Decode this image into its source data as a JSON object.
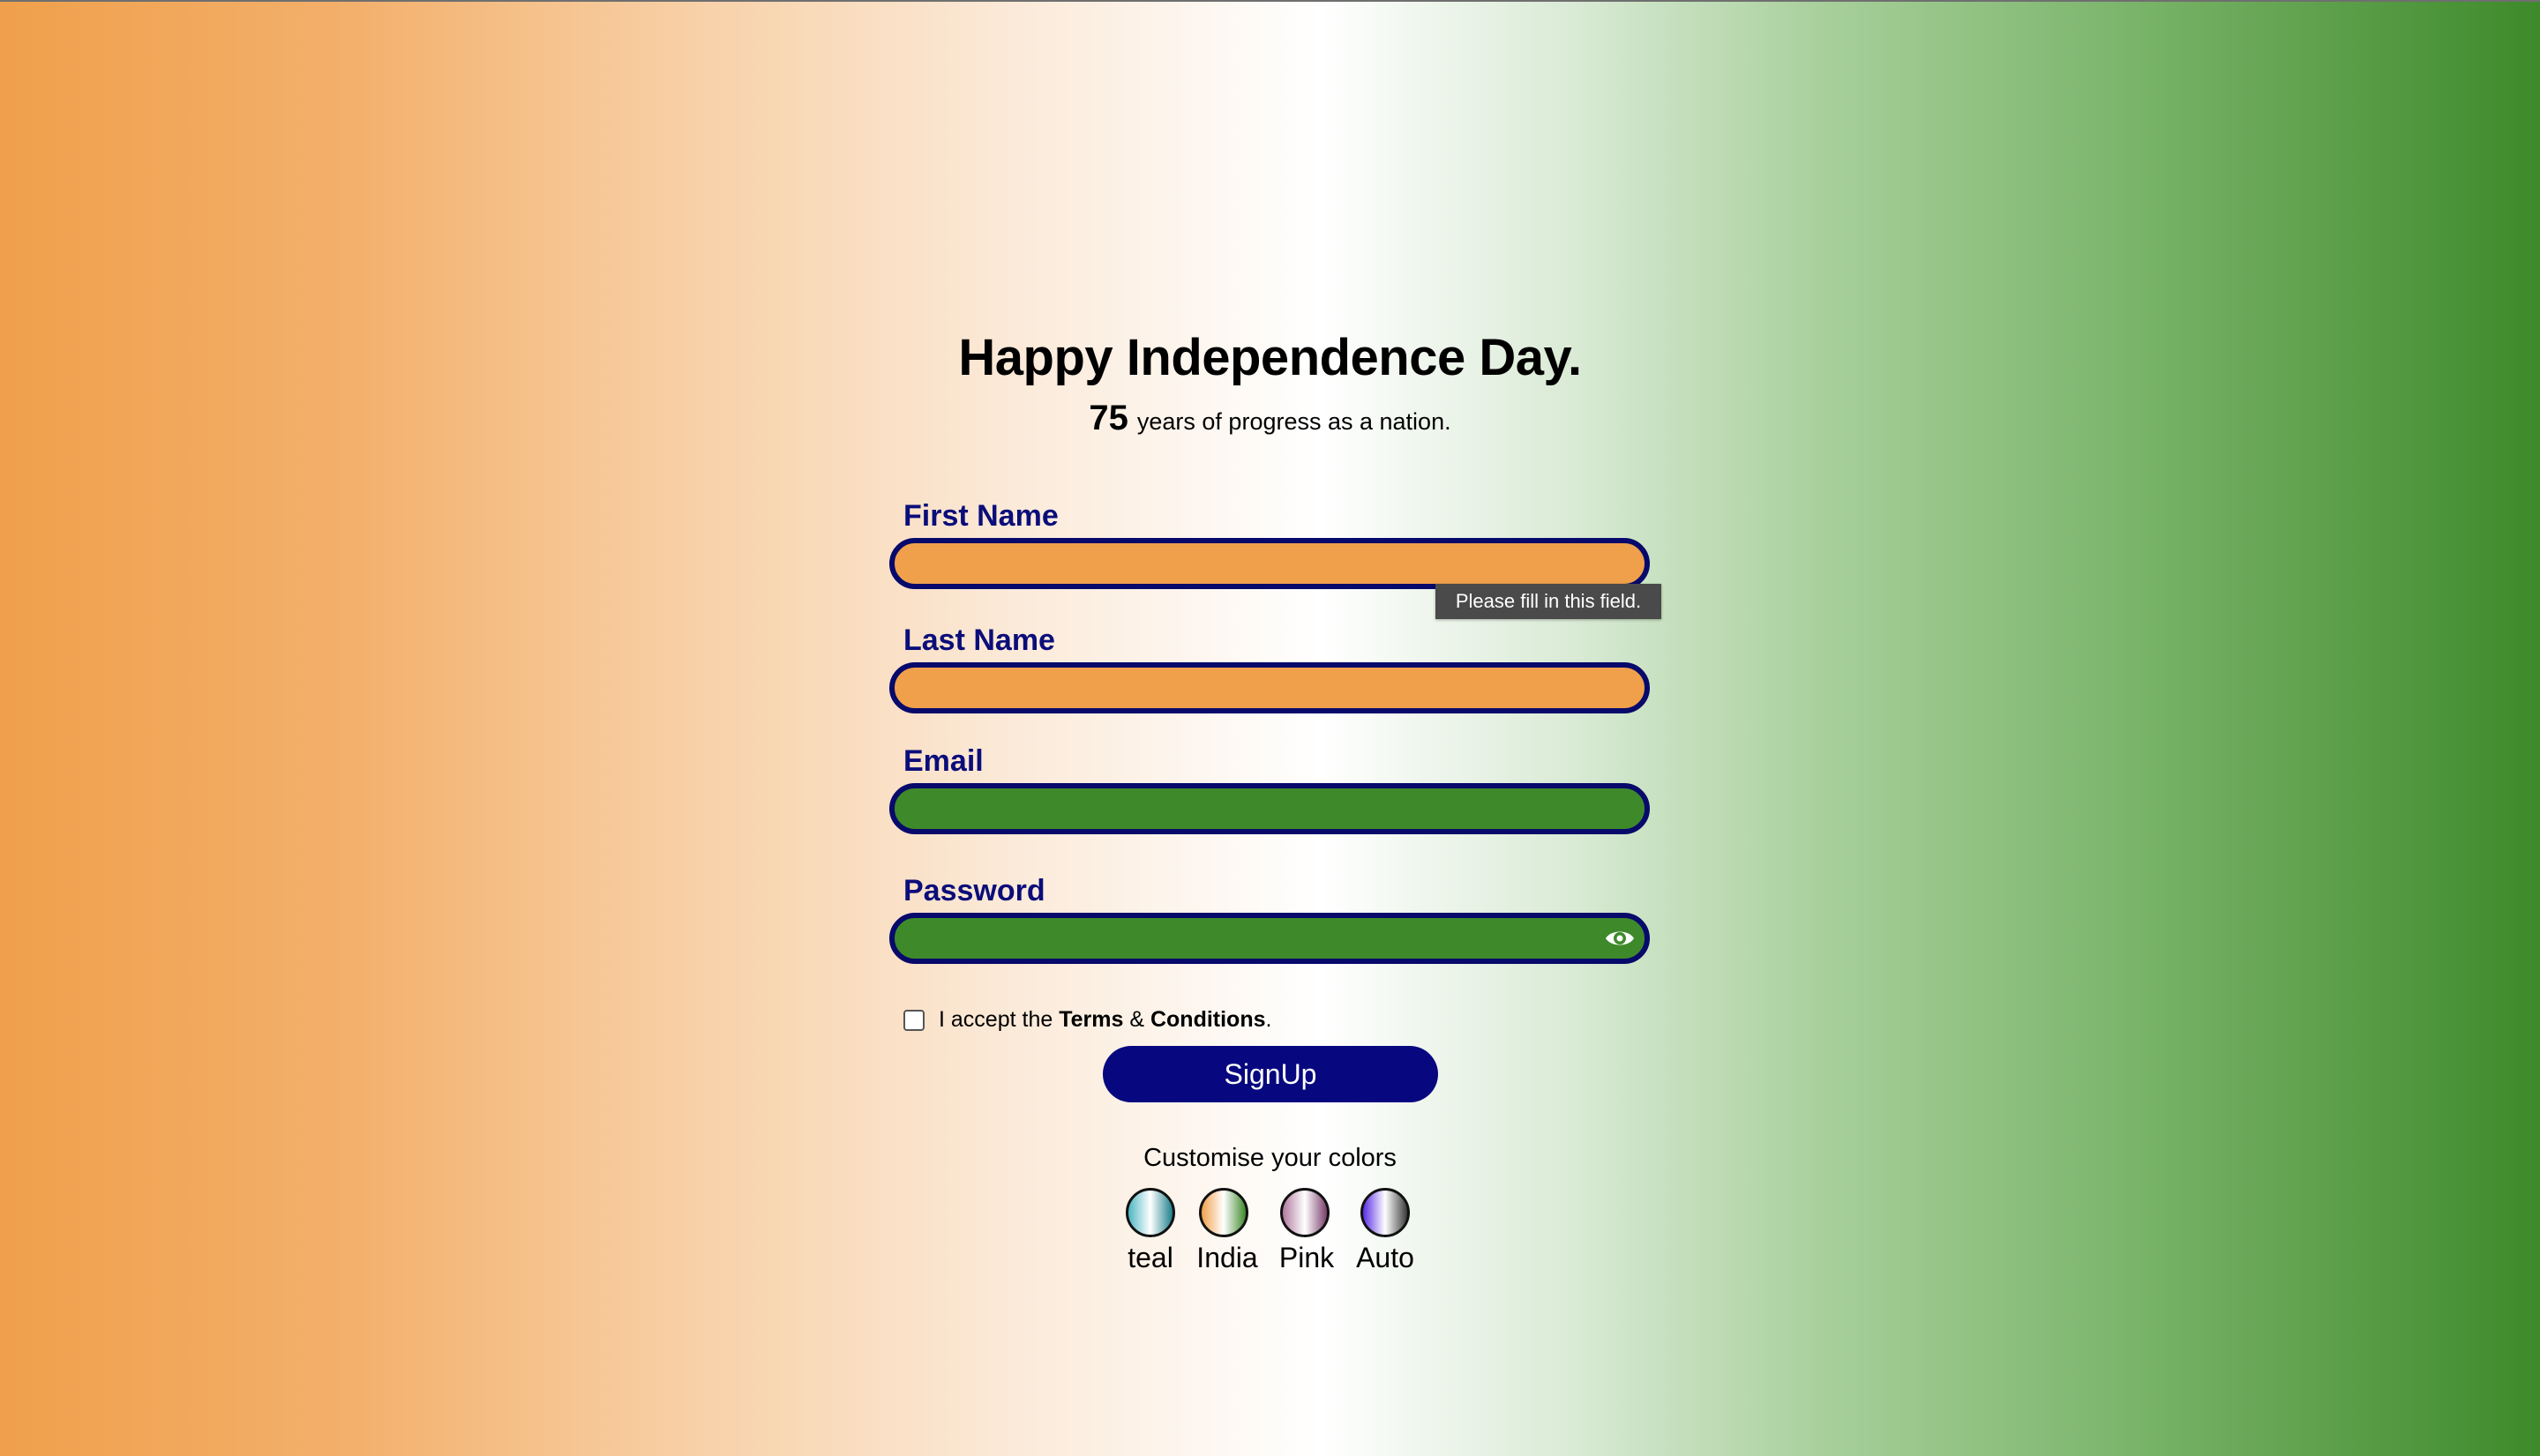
{
  "header": {
    "title": "Happy Independence Day.",
    "years_number": "75",
    "years_text": "years of progress as a nation."
  },
  "form": {
    "first_name_label": "First Name",
    "last_name_label": "Last Name",
    "email_label": "Email",
    "password_label": "Password",
    "validation_tooltip": "Please fill in this field.",
    "terms_prefix": "I accept the ",
    "terms_bold1": "Terms",
    "terms_amp": " & ",
    "terms_bold2": "Conditions",
    "terms_suffix": ".",
    "signup_label": "SignUp"
  },
  "themes": {
    "heading": "Customise your colors",
    "options": [
      {
        "label": "teal",
        "colors": [
          "#4fb6c2",
          "#ffffff",
          "#1b7f8a"
        ]
      },
      {
        "label": "India",
        "colors": [
          "#f0a04b",
          "#ffffff",
          "#3e8a2a"
        ]
      },
      {
        "label": "Pink",
        "colors": [
          "#b07a9f",
          "#ffffff",
          "#7a3e6b"
        ]
      },
      {
        "label": "Auto",
        "colors": [
          "#5a2ee6",
          "#ffffff",
          "#3a3a3a"
        ]
      }
    ]
  },
  "colors": {
    "saffron": "#f0a04b",
    "green": "#3e8a2a",
    "navy": "#07087f",
    "label_navy": "#0b0d7a"
  },
  "icons": {
    "password_toggle": "eye-icon"
  }
}
